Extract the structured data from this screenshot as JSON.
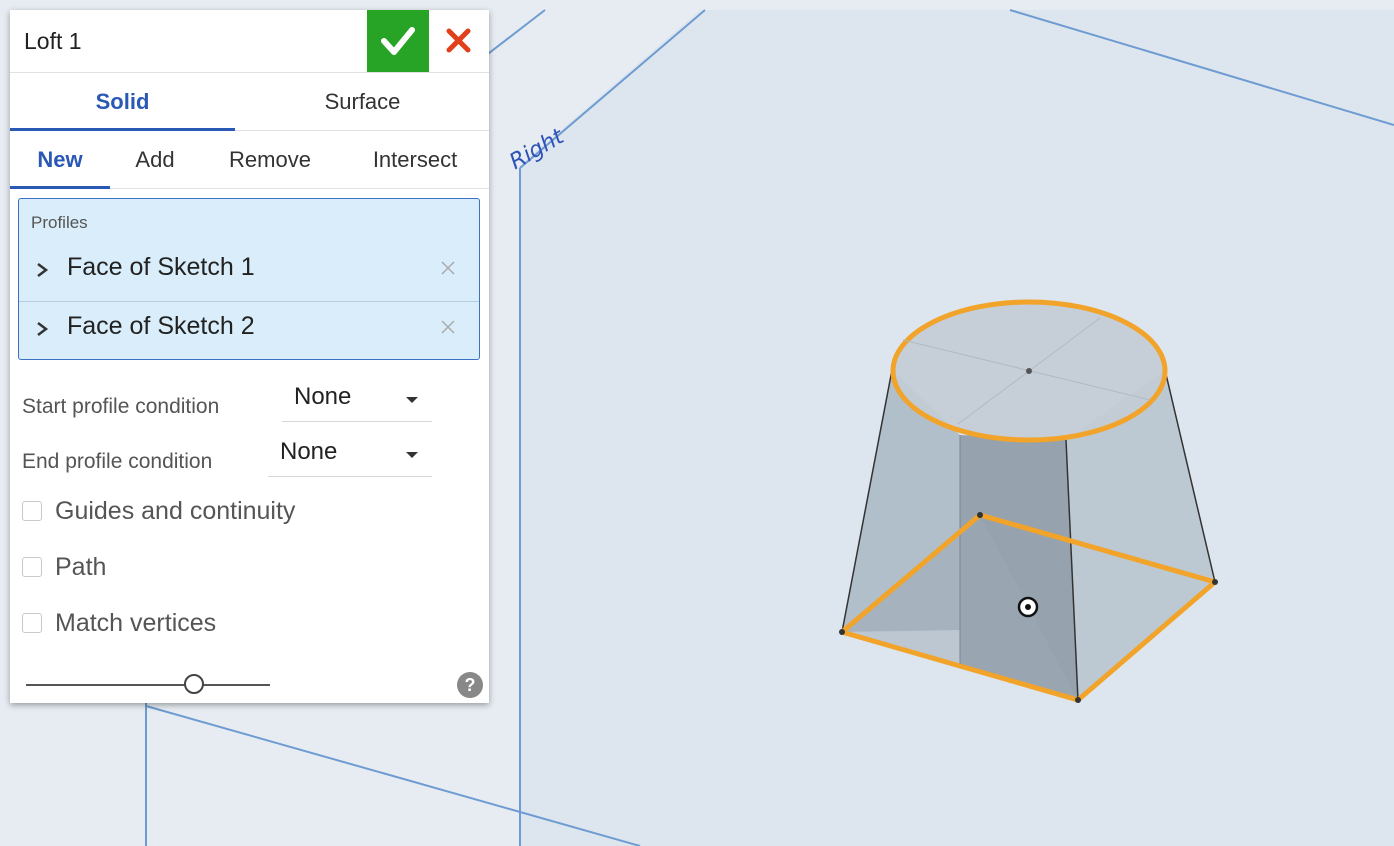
{
  "feature": {
    "title": "Loft 1"
  },
  "tabs": [
    {
      "label": "Solid",
      "active": true
    },
    {
      "label": "Surface",
      "active": false
    }
  ],
  "operations": [
    {
      "label": "New",
      "active": true
    },
    {
      "label": "Add",
      "active": false
    },
    {
      "label": "Remove",
      "active": false
    },
    {
      "label": "Intersect",
      "active": false
    }
  ],
  "profiles": {
    "caption": "Profiles",
    "items": [
      {
        "label": "Face of Sketch 1"
      },
      {
        "label": "Face of Sketch 2"
      }
    ]
  },
  "conditions": {
    "start": {
      "label": "Start profile condition",
      "value": "None"
    },
    "end": {
      "label": "End profile condition",
      "value": "None"
    }
  },
  "options": [
    {
      "label": "Guides and continuity",
      "checked": false
    },
    {
      "label": "Path",
      "checked": false
    },
    {
      "label": "Match vertices",
      "checked": false
    }
  ],
  "slider": {
    "fraction": 0.69
  },
  "help": {
    "glyph": "?"
  },
  "viewport": {
    "plane_label": "Right"
  },
  "colors": {
    "accent": "#2a58b5",
    "ok": "#27a325",
    "cancel": "#e2401c",
    "highlight": "#f2a32a"
  }
}
